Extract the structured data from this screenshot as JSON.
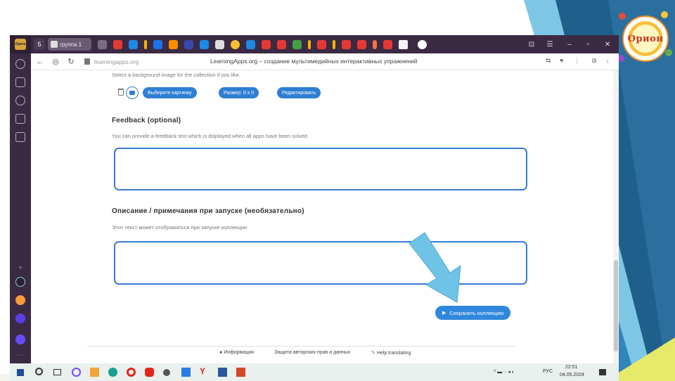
{
  "slide": {
    "logo_text": "Орион",
    "colors": {
      "dark_blue": "#1f5f8b",
      "mid_blue": "#2f86b9",
      "light_blue": "#7ec6e6",
      "arrow": "#6fc3e6"
    }
  },
  "browser": {
    "badge": "Opera",
    "tab_count": "5",
    "active_tab": "группа 1",
    "url": "learningapps.org",
    "page_title": "LearningApps.org – создание мультимедийных интерактивных упражнений",
    "back_icon": "arrow-left-icon",
    "forward_icon": "speed-dial-icon",
    "reload_icon": "reload-icon"
  },
  "content": {
    "bg_hint": "Select a background image for the collection if you like.",
    "buttons": {
      "choose_image": "Выберите картинку",
      "size": "Размер: 0 x 0",
      "edit": "Редактировать"
    },
    "feedback": {
      "heading": "Feedback (optional)",
      "hint": "You can provide a feedback text which is displayed when all apps have been solved.",
      "value": ""
    },
    "description": {
      "heading": "Описание / примечания при запуске (необязательно)",
      "hint": "Этот текст может отображаться при запуске коллекции.",
      "value": ""
    },
    "save_button": "Сохранить коллекцию",
    "footer": {
      "info": "Информация",
      "privacy": "Защита авторских прав и данных",
      "translate": "Help translating"
    }
  },
  "taskbar": {
    "lang": "РУС",
    "time": "22:51",
    "date": "04.05.2024"
  }
}
